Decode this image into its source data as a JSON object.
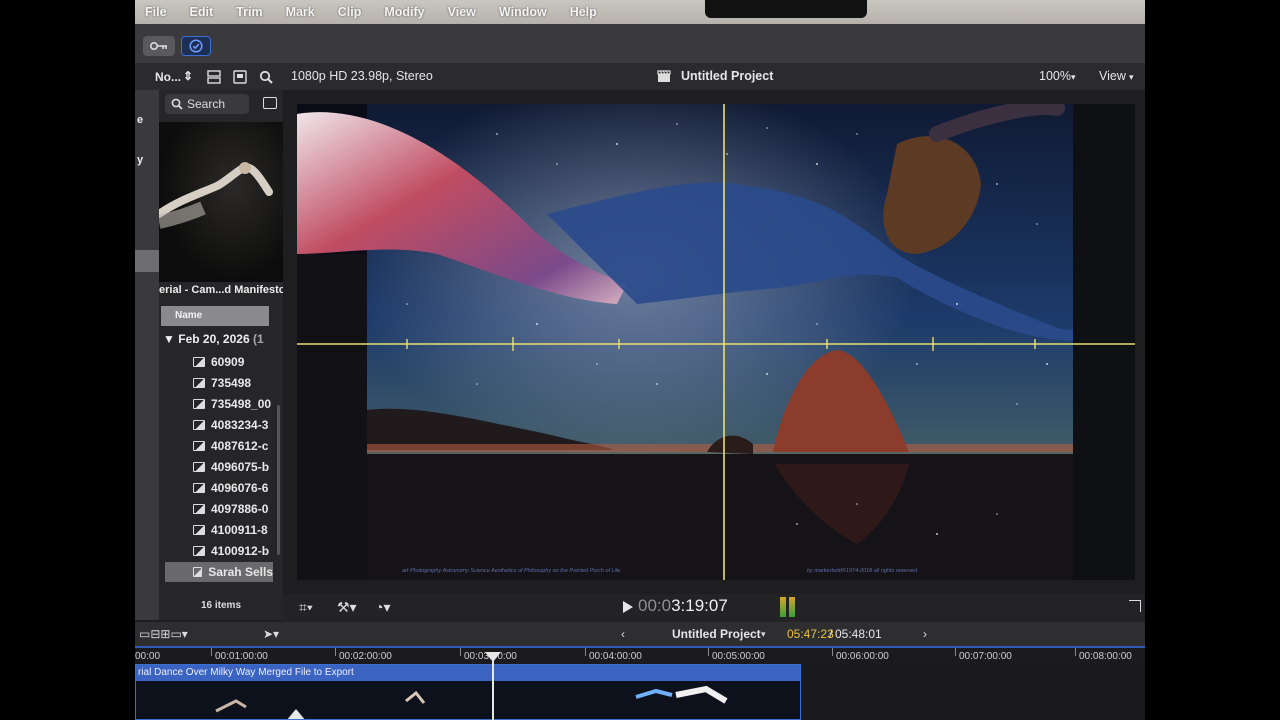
{
  "menu": [
    "File",
    "Edit",
    "Trim",
    "Mark",
    "Clip",
    "Modify",
    "View",
    "Window",
    "Help"
  ],
  "browser_header": {
    "truncated_label": "No...",
    "stepper": "⇕"
  },
  "viewer_header": {
    "format": "1080p HD 23.98p, Stereo",
    "project": "Untitled Project",
    "zoom": "100%",
    "view": "View"
  },
  "sidebar": {
    "fragments": [
      "e",
      "y"
    ]
  },
  "browser": {
    "search_placeholder": "Search",
    "thumbnail_label": "erial - Cam...d Manifesto",
    "column_header": "Name",
    "group": "Feb 20, 2026",
    "group_count": "(1",
    "clips": [
      "60909",
      "735498",
      "735498_00",
      "4083234-3",
      "4087612-c",
      "4096075-b",
      "4096076-6",
      "4097886-0",
      "4100911-8",
      "4100912-b"
    ],
    "selected_clip": "Sarah Sells",
    "items_count": "16 items"
  },
  "viewer": {
    "watermark": "art  Photography  Astronomy  Science  Aesthetics  of  Philosophy  on  the  Pointed  Porch  of  Life",
    "credit": "by          markerbold©1974-2018                     all  rights  reserved",
    "timecode_dim": "00:0",
    "timecode_bright": "3:19:07"
  },
  "timeline": {
    "project": "Untitled Project",
    "current": "05:47:23",
    "separator": "/",
    "duration": "05:48:01",
    "ruler": [
      "00:00",
      "00:01:00:00",
      "00:02:00:00",
      "00:03:00:00",
      "00:04:00:00",
      "00:05:00:00",
      "00:06:00:00",
      "00:07:00:00",
      "00:08:00:00"
    ],
    "clip_title": "rial Dance Over Milky Way Merged File to Export"
  },
  "colors": {
    "accent": "#3a63c2",
    "timecode_yellow": "#e8c23a",
    "guide": "#e8e070"
  }
}
